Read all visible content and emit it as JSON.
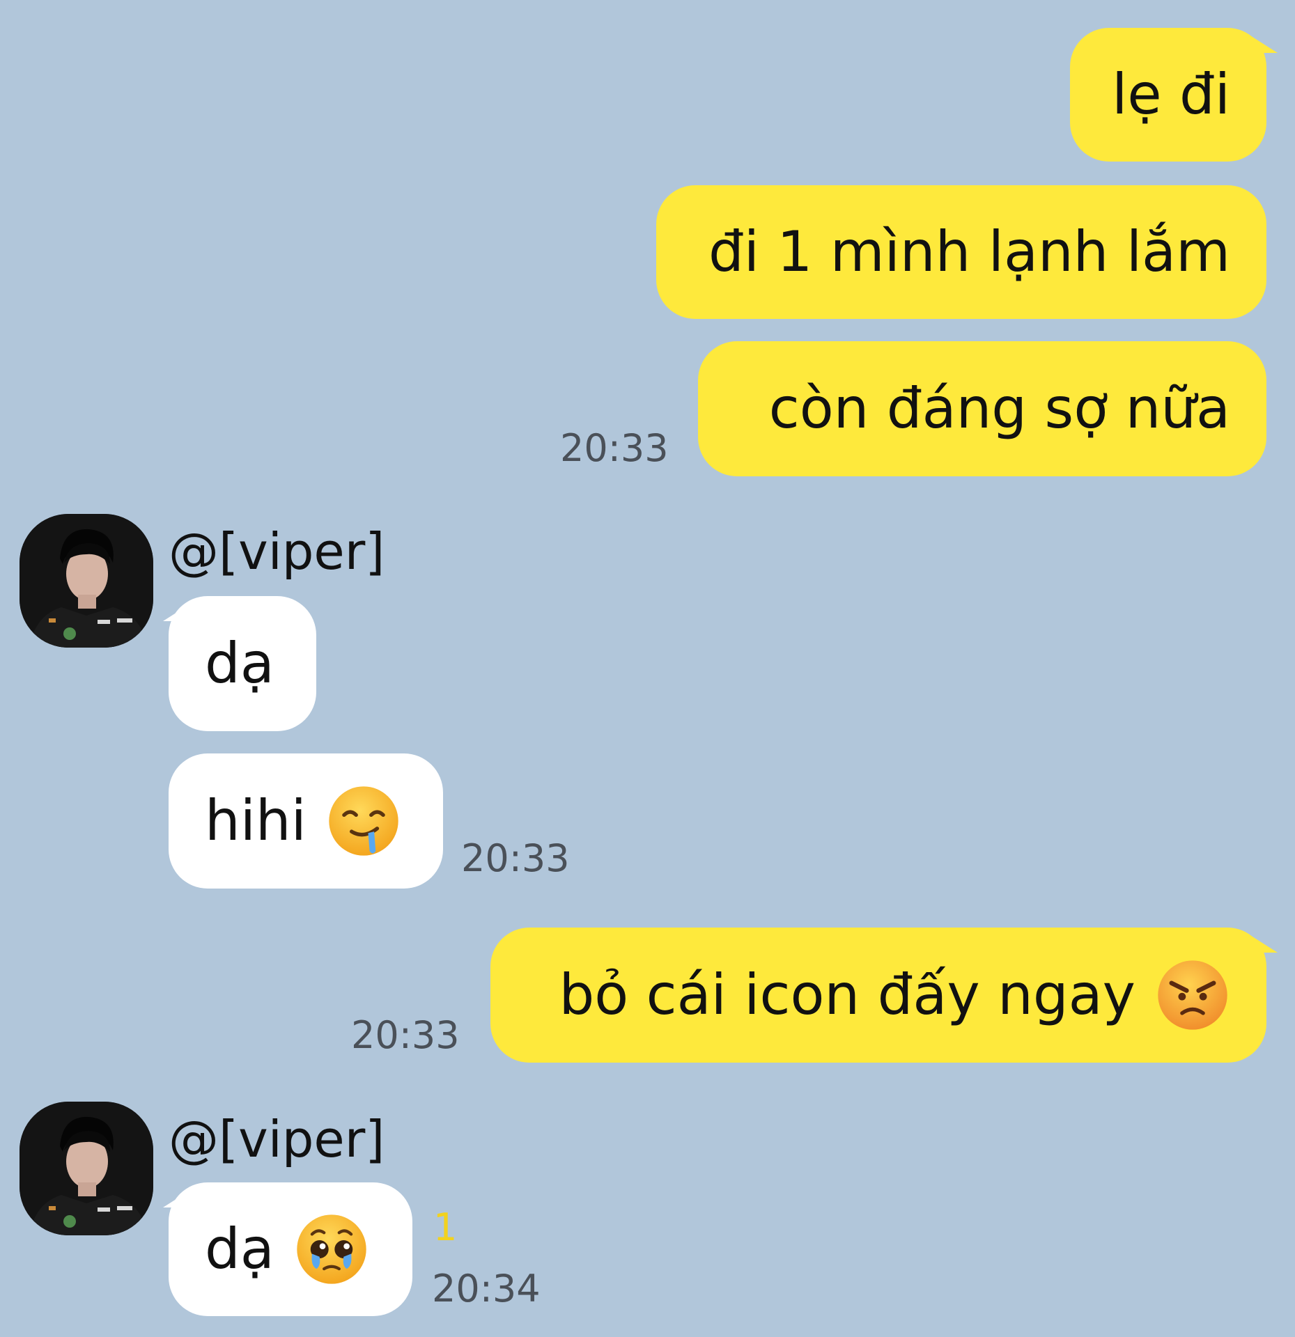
{
  "messages": [
    {
      "text": "lẹ đi"
    },
    {
      "text": "đi 1 mình lạnh lắm"
    },
    {
      "text": "còn đáng sợ nữa",
      "time": "20:33"
    },
    {
      "sender": "@[viper]",
      "text": "dạ"
    },
    {
      "text": "hihi",
      "emoji": "drooling-face-icon",
      "time": "20:33"
    },
    {
      "text": "bỏ cái icon đấy ngay",
      "emoji": "angry-face-icon",
      "time": "20:33"
    },
    {
      "sender": "@[viper]",
      "text": "dạ",
      "emoji": "pleading-face-icon",
      "unread": "1",
      "time": "20:34"
    }
  ],
  "colors": {
    "background": "#b1c6da",
    "outgoing_bubble": "#fee93c",
    "incoming_bubble": "#ffffff",
    "unread_count": "#f2d21e"
  }
}
